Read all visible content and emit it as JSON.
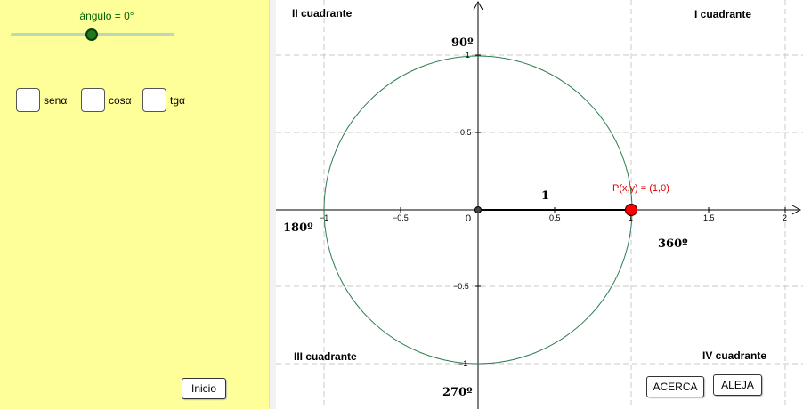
{
  "algebra": {
    "slider_label": "ángulo = 0°",
    "slider_value_fraction": 0.5,
    "checkboxes": [
      {
        "label": "senα"
      },
      {
        "label": "cosα"
      },
      {
        "label": "tgα"
      }
    ],
    "inicio_button": "Inicio"
  },
  "graphics": {
    "quadrants": {
      "q1": "I cuadrante",
      "q2": "II cuadrante",
      "q3": "III cuadrante",
      "q4": "IV cuadrante"
    },
    "angles": {
      "a90": "90º",
      "a180": "180º",
      "a270": "270º",
      "a360": "360º"
    },
    "x_ticks": [
      "−1",
      "−0.5",
      "0",
      "0.5",
      "1",
      "1.5",
      "2"
    ],
    "y_ticks": [
      "1",
      "0.5",
      "−0.5",
      "−1"
    ],
    "radius_label": "1",
    "point_label": "P(x,y) = (1,0)",
    "buttons": {
      "acerca": "ACERCA",
      "aleja": "ALEJA"
    },
    "colors": {
      "circle": "#2e7d4f",
      "point": "#ff0000",
      "grid": "#c8c8c8",
      "panel": "#ffff99"
    }
  }
}
